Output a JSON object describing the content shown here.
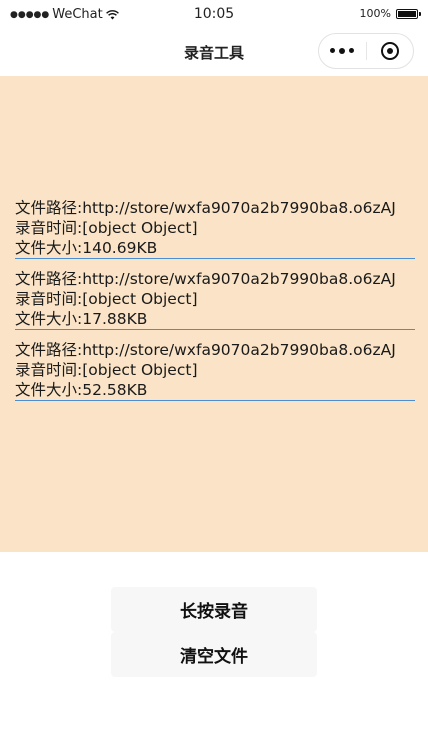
{
  "status_bar": {
    "carrier_dots": "●●●●●",
    "carrier": "WeChat",
    "time": "10:05",
    "battery_text": "100%"
  },
  "nav": {
    "title": "录音工具",
    "icons": [
      "more-dots-icon",
      "close-circle-icon"
    ]
  },
  "records": [
    {
      "path_label": "文件路径:http://store/wxfa9070a2b7990ba8.o6zAJ",
      "time_label": "录音时间:[object Object]",
      "size_label": "文件大小:140.69KB"
    },
    {
      "path_label": "文件路径:http://store/wxfa9070a2b7990ba8.o6zAJ",
      "time_label": "录音时间:[object Object]",
      "size_label": "文件大小:17.88KB"
    },
    {
      "path_label": "文件路径:http://store/wxfa9070a2b7990ba8.o6zAJ",
      "time_label": "录音时间:[object Object]",
      "size_label": "文件大小:52.58KB"
    }
  ],
  "buttons": {
    "record_label": "长按录音",
    "clear_label": "清空文件"
  },
  "colors": {
    "records_background": "#fae3c6",
    "divider": "#4a8fd6",
    "button_background": "#f7f7f7"
  }
}
